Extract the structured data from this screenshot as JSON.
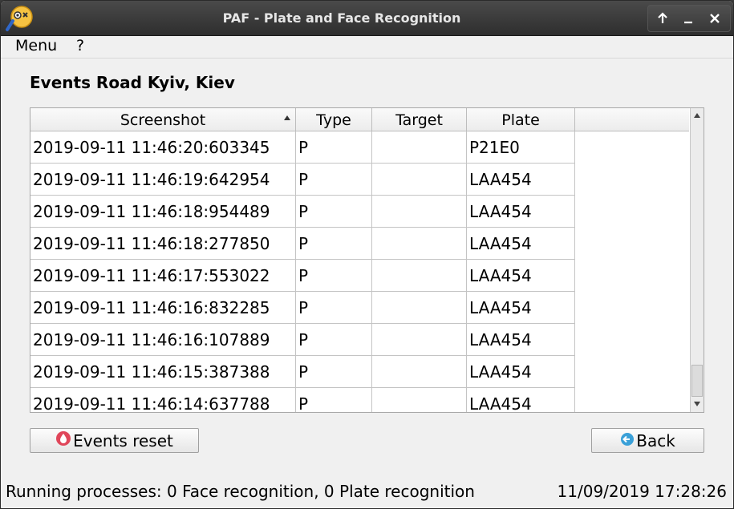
{
  "window": {
    "title": "PAF - Plate and Face Recognition"
  },
  "menu": {
    "items": [
      {
        "label": "Menu"
      },
      {
        "label": "?"
      }
    ]
  },
  "page": {
    "title": "Events Road Kyiv, Kiev"
  },
  "table": {
    "columns": [
      "Screenshot",
      "Type",
      "Target",
      "Plate"
    ],
    "sorted_column": "Screenshot",
    "rows": [
      {
        "screenshot": "2019-09-11 11:46:20:603345",
        "type": "P",
        "target": "",
        "plate": "P21E0"
      },
      {
        "screenshot": "2019-09-11 11:46:19:642954",
        "type": "P",
        "target": "",
        "plate": "LAA454"
      },
      {
        "screenshot": "2019-09-11 11:46:18:954489",
        "type": "P",
        "target": "",
        "plate": "LAA454"
      },
      {
        "screenshot": "2019-09-11 11:46:18:277850",
        "type": "P",
        "target": "",
        "plate": "LAA454"
      },
      {
        "screenshot": "2019-09-11 11:46:17:553022",
        "type": "P",
        "target": "",
        "plate": "LAA454"
      },
      {
        "screenshot": "2019-09-11 11:46:16:832285",
        "type": "P",
        "target": "",
        "plate": "LAA454"
      },
      {
        "screenshot": "2019-09-11 11:46:16:107889",
        "type": "P",
        "target": "",
        "plate": "LAA454"
      },
      {
        "screenshot": "2019-09-11 11:46:15:387388",
        "type": "P",
        "target": "",
        "plate": "LAA454"
      },
      {
        "screenshot": "2019-09-11 11:46:14:637788",
        "type": "P",
        "target": "",
        "plate": "LAA454"
      }
    ]
  },
  "buttons": {
    "events_reset": "Events reset",
    "back": "Back"
  },
  "status": {
    "processes": "Running processes: 0 Face recognition, 0 Plate recognition",
    "datetime": "11/09/2019 17:28:26"
  },
  "colors": {
    "reset_icon": "#e0465a",
    "back_icon": "#3aa0d8",
    "titlebar": "#383838"
  }
}
